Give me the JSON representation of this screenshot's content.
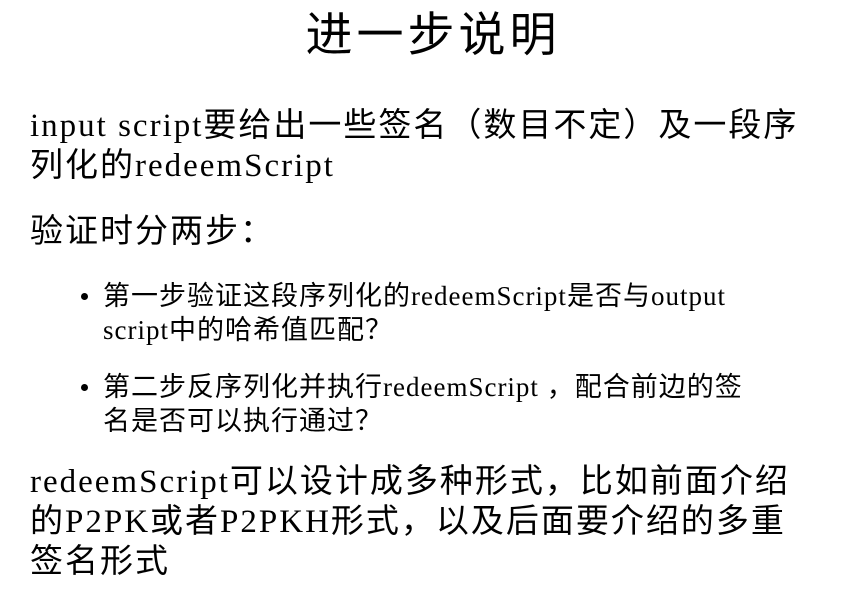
{
  "title": "进一步说明",
  "intro": {
    "lines": [
      "input script要给出一些签名（数目不定）及一段序",
      "列化的redeemScript"
    ]
  },
  "steps_heading": "验证时分两步：",
  "steps": [
    {
      "lines": [
        "第一步验证这段序列化的redeemScript是否与output",
        "script中的哈希值匹配？"
      ]
    },
    {
      "lines": [
        "第二步反序列化并执行redeemScript ，配合前边的签",
        "名是否可以执行通过？"
      ]
    }
  ],
  "conclusion": {
    "lines": [
      "redeemScript可以设计成多种形式，比如前面介绍",
      "的P2PK或者P2PKH形式，以及后面要介绍的多重",
      "签名形式"
    ]
  }
}
